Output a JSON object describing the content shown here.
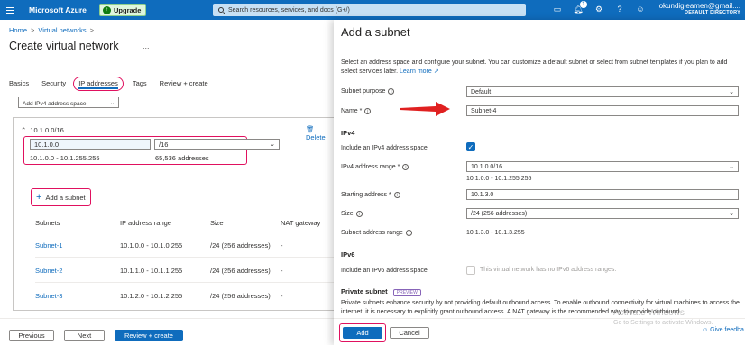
{
  "topbar": {
    "brand": "Microsoft Azure",
    "upgrade_label": "Upgrade",
    "search_placeholder": "Search resources, services, and docs (G+/)",
    "notification_count": "1",
    "account_name": "okundigieamen@gmail....",
    "account_directory": "DEFAULT DIRECTORY"
  },
  "left": {
    "breadcrumb": [
      "Home",
      ">",
      "Virtual networks",
      ">"
    ],
    "title": "Create virtual network",
    "ellipsis": "...",
    "tabs": [
      "Basics",
      "Security",
      "IP addresses",
      "Tags",
      "Review + create"
    ],
    "add_space_label": "Add IPv4 address space",
    "address_space": {
      "cidr_label": "10.1.0.0/16",
      "delete_label": "Delete",
      "ip_value": "10.1.0.0",
      "prefix_value": "/16",
      "range": "10.1.0.0 - 10.1.255.255",
      "count": "65,536 addresses"
    },
    "add_subnet_label": "Add a subnet",
    "table": {
      "headers": [
        "Subnets",
        "IP address range",
        "Size",
        "NAT gateway"
      ],
      "rows": [
        {
          "name": "Subnet-1",
          "range": "10.1.0.0 - 10.1.0.255",
          "size": "/24 (256 addresses)",
          "nat": "-"
        },
        {
          "name": "Subnet-2",
          "range": "10.1.1.0 - 10.1.1.255",
          "size": "/24 (256 addresses)",
          "nat": "-"
        },
        {
          "name": "Subnet-3",
          "range": "10.1.2.0 - 10.1.2.255",
          "size": "/24 (256 addresses)",
          "nat": "-"
        }
      ]
    },
    "footer": {
      "previous": "Previous",
      "next": "Next",
      "review": "Review + create"
    }
  },
  "panel": {
    "title": "Add a subnet",
    "intro": "Select an address space and configure your subnet. You can customize a default subnet or select from subnet templates if you plan to add select services later.",
    "learn_more": "Learn more",
    "subnet_purpose_label": "Subnet purpose",
    "subnet_purpose_value": "Default",
    "name_label": "Name *",
    "name_value": "Subnet-4",
    "ipv4_section": "IPv4",
    "include_ipv4_label": "Include an IPv4 address space",
    "ipv4_range_label": "IPv4 address range *",
    "ipv4_range_value": "10.1.0.0/16",
    "ipv4_range_hint": "10.1.0.0 - 10.1.255.255",
    "starting_address_label": "Starting address *",
    "starting_address_value": "10.1.3.0",
    "size_label": "Size",
    "size_value": "/24 (256 addresses)",
    "subnet_range_label": "Subnet address range",
    "subnet_range_value": "10.1.3.0 - 10.1.3.255",
    "ipv6_section": "IPv6",
    "include_ipv6_label": "Include an IPv6 address space",
    "ipv6_disabled_text": "This virtual network has no IPv6 address ranges.",
    "private_subnet_title": "Private subnet",
    "preview_badge": "PREVIEW",
    "private_subnet_desc": "Private subnets enhance security by not providing default outbound access. To enable outbound connectivity for virtual machines to access the internet, it is necessary to explicitly grant outbound access. A NAT gateway is the recommended way to provide outbound",
    "add_button": "Add",
    "cancel_button": "Cancel"
  },
  "overlay": {
    "watermark_title": "Activate Windows",
    "watermark_sub": "Go to Settings to activate Windows.",
    "feedback": "Give feedba"
  },
  "colors": {
    "azure_blue": "#0f6cbd",
    "highlight": "#e0115f",
    "arrow": "#e02020"
  }
}
